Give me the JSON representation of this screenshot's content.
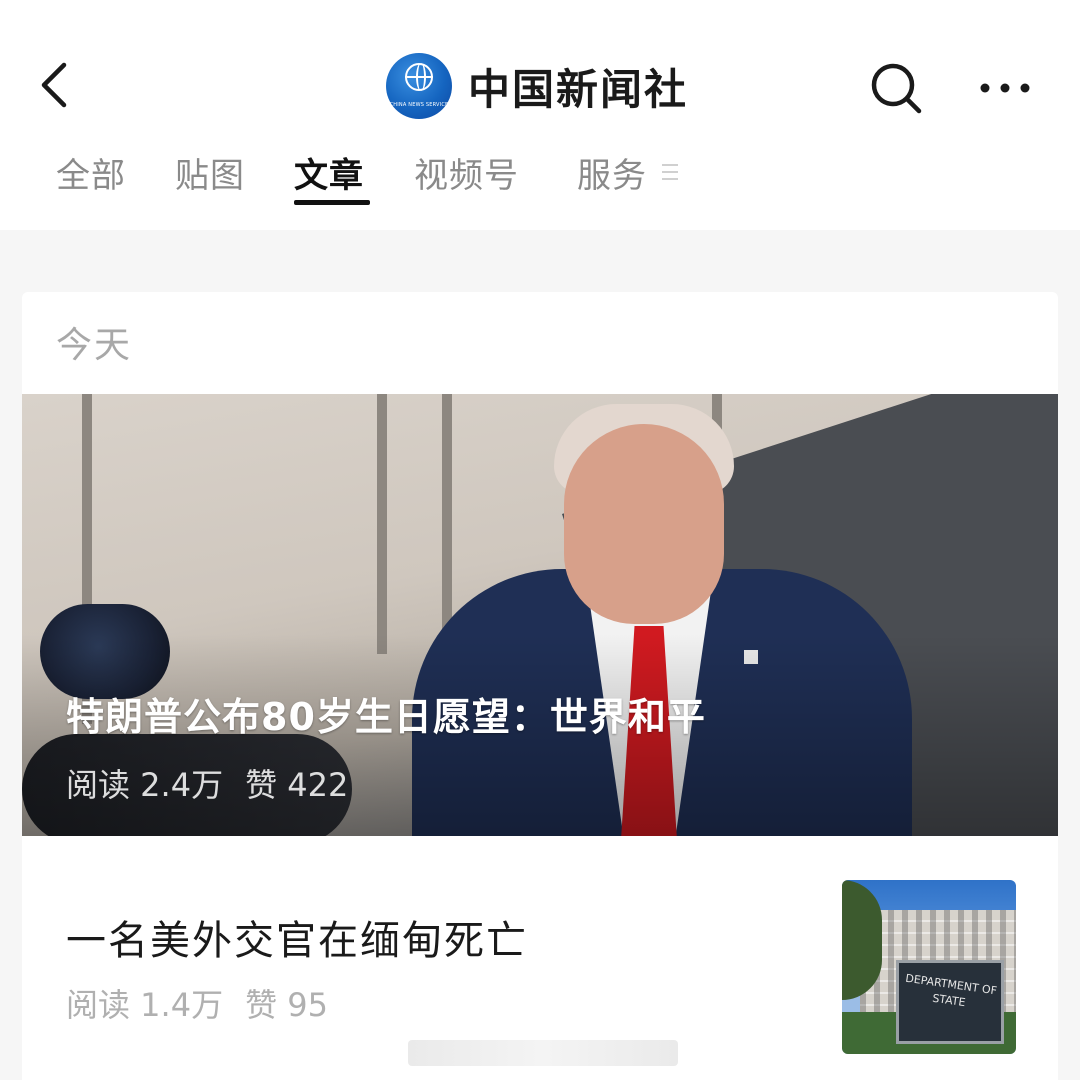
{
  "header": {
    "account_name": "中国新闻社",
    "logo_text": "CHINA NEWS SERVICE",
    "icons": {
      "back": "back-icon",
      "search": "search-icon",
      "more": "more-icon"
    }
  },
  "tabs": [
    {
      "label": "全部",
      "active": false
    },
    {
      "label": "贴图",
      "active": false
    },
    {
      "label": "文章",
      "active": true
    },
    {
      "label": "视频号",
      "active": false
    },
    {
      "label": "服务",
      "active": false
    }
  ],
  "feed": {
    "date_label": "今天",
    "articles": [
      {
        "title": "特朗普公布80岁生日愿望：世界和平",
        "reads": "阅读 2.4万",
        "likes": "赞 422"
      },
      {
        "title": "一名美外交官在缅甸死亡",
        "reads": "阅读 1.4万",
        "likes": "赞 95",
        "thumb_sign_text": "DEPARTMENT OF STATE"
      }
    ]
  },
  "colors": {
    "active_tab": "#111111",
    "inactive_tab": "#8a8a8a",
    "logo_blue": "#1565c0",
    "background": "#f6f6f6"
  }
}
